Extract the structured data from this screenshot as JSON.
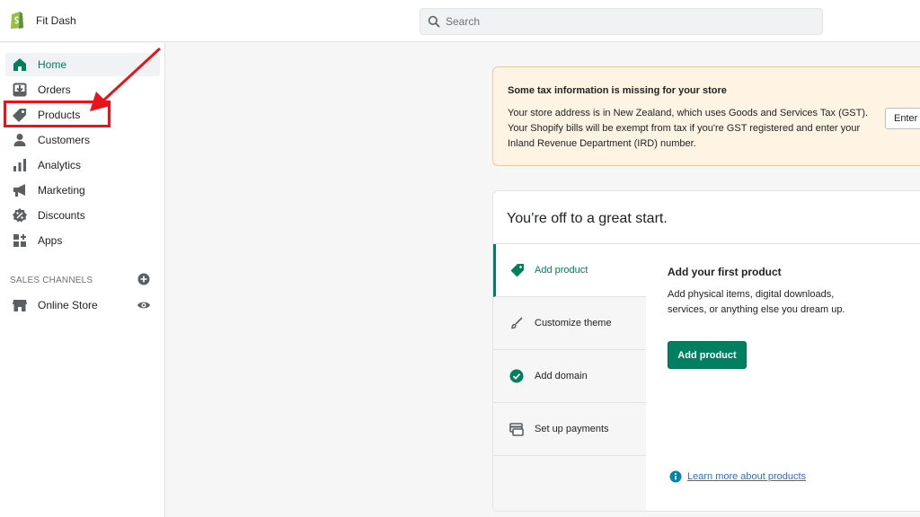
{
  "header": {
    "store_name": "Fit Dash",
    "search_placeholder": "Search"
  },
  "sidebar": {
    "items": [
      {
        "label": "Home",
        "icon": "home-icon",
        "active": true
      },
      {
        "label": "Orders",
        "icon": "orders-icon"
      },
      {
        "label": "Products",
        "icon": "tag-icon"
      },
      {
        "label": "Customers",
        "icon": "person-icon"
      },
      {
        "label": "Analytics",
        "icon": "bar-chart-icon"
      },
      {
        "label": "Marketing",
        "icon": "megaphone-icon"
      },
      {
        "label": "Discounts",
        "icon": "discount-icon"
      },
      {
        "label": "Apps",
        "icon": "apps-icon"
      }
    ],
    "sales_channels_title": "SALES CHANNELS",
    "channels": [
      {
        "label": "Online Store",
        "icon": "store-icon"
      }
    ]
  },
  "banner": {
    "title": "Some tax information is missing for your store",
    "text": "Your store address is in New Zealand, which uses Goods and Services Tax (GST). Your Shopify bills will be exempt from tax if you're GST registered and enter your Inland Revenue Department (IRD) number.",
    "button_label": "Enter I"
  },
  "setup_card": {
    "title": "You’re off to a great start.",
    "tabs": [
      {
        "label": "Add product",
        "icon": "tag-icon",
        "active": true
      },
      {
        "label": "Customize theme",
        "icon": "brush-icon"
      },
      {
        "label": "Add domain",
        "icon": "check-circle-icon"
      },
      {
        "label": "Set up payments",
        "icon": "payments-icon"
      }
    ],
    "panel": {
      "title": "Add your first product",
      "text": "Add physical items, digital downloads, services, or anything else you dream up.",
      "button_label": "Add product",
      "link_label": "Learn more about products"
    }
  },
  "colors": {
    "accent": "#008060",
    "highlight": "#e8141b",
    "banner_bg": "#fff4e4",
    "link": "#2c6ecb"
  }
}
